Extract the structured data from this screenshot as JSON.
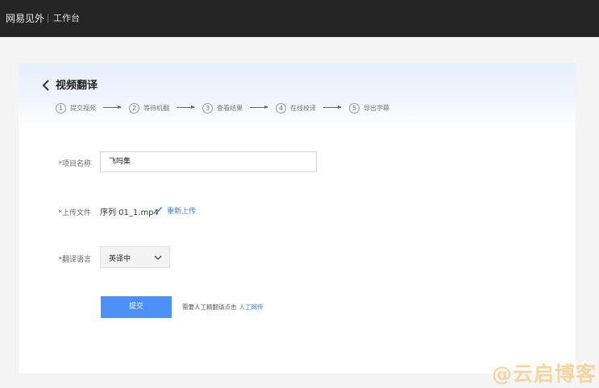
{
  "topbar": {
    "brand": "网易见外",
    "workspace": "工作台",
    "background": "#252525"
  },
  "header": {
    "back_icon": "chevron-left-icon",
    "title": "视频翻译",
    "steps": [
      {
        "num": "1",
        "label": "提交视频"
      },
      {
        "num": "2",
        "label": "等待机翻"
      },
      {
        "num": "3",
        "label": "查看结果"
      },
      {
        "num": "4",
        "label": "在线校译"
      },
      {
        "num": "5",
        "label": "导出字幕"
      }
    ]
  },
  "form": {
    "project_name": {
      "label": "*项目名称",
      "value": "飞吗集"
    },
    "upload": {
      "label": "*上传文件",
      "file_name": "序列 01_1.mp4",
      "check_icon": "check-icon",
      "reupload_label": "重新上传"
    },
    "language": {
      "label": "*翻译语言",
      "selected": "英译中",
      "chevron_icon": "chevron-down-icon"
    },
    "submit_label": "提交",
    "hint_text": "需要人工精翻请点击",
    "hint_link": "人工网传"
  },
  "watermark": "@云启博客",
  "colors": {
    "accent": "#4c8ff6",
    "link": "#3a7be0"
  }
}
